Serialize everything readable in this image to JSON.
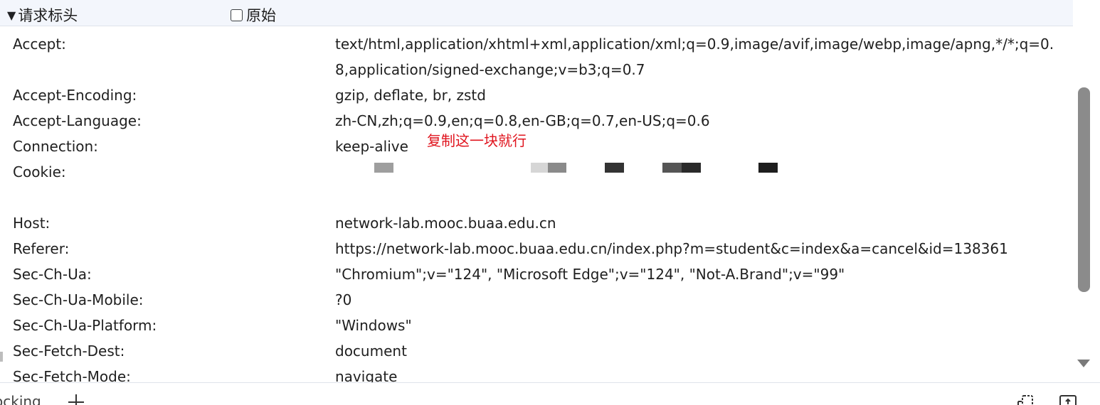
{
  "section": {
    "toggle_label": "请求标头",
    "raw_label": "原始"
  },
  "headers": [
    {
      "name": "Accept:",
      "value": "text/html,application/xhtml+xml,application/xml;q=0.9,image/avif,image/webp,image/apng,*/*;q=0.8,application/signed-exchange;v=b3;q=0.7"
    },
    {
      "name": "Accept-Encoding:",
      "value": "gzip, deflate, br, zstd"
    },
    {
      "name": "Accept-Language:",
      "value": "zh-CN,zh;q=0.9,en;q=0.8,en-GB;q=0.7,en-US;q=0.6"
    },
    {
      "name": "Connection:",
      "value": "keep-alive"
    },
    {
      "name": "Cookie:",
      "value": ""
    },
    {
      "name": "Host:",
      "value": "network-lab.mooc.buaa.edu.cn"
    },
    {
      "name": "Referer:",
      "value": "https://network-lab.mooc.buaa.edu.cn/index.php?m=student&c=index&a=cancel&id=138361"
    },
    {
      "name": "Sec-Ch-Ua:",
      "value": "\"Chromium\";v=\"124\", \"Microsoft Edge\";v=\"124\", \"Not-A.Brand\";v=\"99\""
    },
    {
      "name": "Sec-Ch-Ua-Mobile:",
      "value": "?0"
    },
    {
      "name": "Sec-Ch-Ua-Platform:",
      "value": "\"Windows\""
    },
    {
      "name": "Sec-Fetch-Dest:",
      "value": "document"
    },
    {
      "name": "Sec-Fetch-Mode:",
      "value": "navigate"
    }
  ],
  "cookie_annotation": "复制这一块就行",
  "colors": {
    "annotation": "#e0141e",
    "header_bg": "#f3f6fc",
    "scrollbar": "#8b8b8b"
  },
  "bottom": {
    "tab_label": "ocking",
    "icons": [
      "plus-icon",
      "dock-icon",
      "panel-icon"
    ]
  }
}
